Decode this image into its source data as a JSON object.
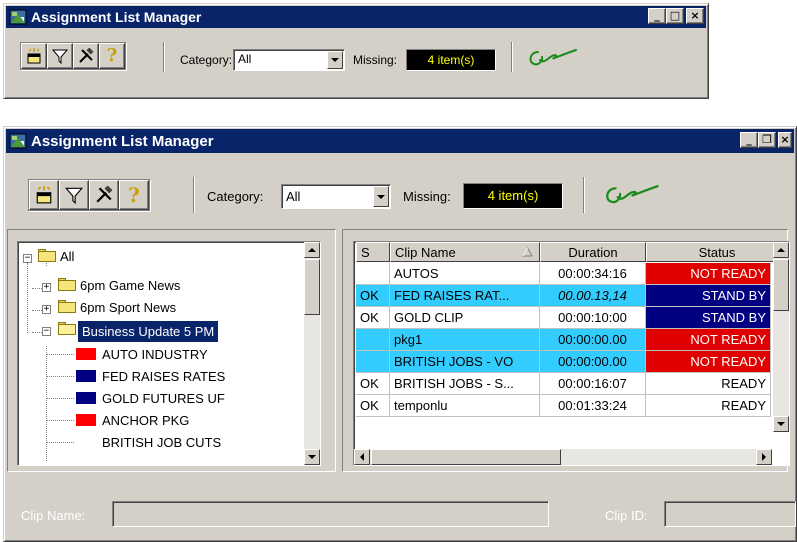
{
  "colors": {
    "titlebar": "#0a246a",
    "selection": "#0a246a",
    "not_ready": "#e00000",
    "stand_by": "#000080",
    "pending_row": "#33ccff",
    "missing_bg": "#000000",
    "missing_text": "#ffff00"
  },
  "small_window": {
    "title": "Assignment List Manager",
    "caption_buttons": [
      "minimize",
      "maximize",
      "close"
    ],
    "toolbar_icons": [
      "new-clip-icon",
      "filter-icon",
      "tools-icon",
      "help-icon"
    ],
    "category_label": "Category:",
    "category_value": "All",
    "missing_label": "Missing:",
    "missing_value": "4 item(s)",
    "signature_icon": "signature-icon"
  },
  "large_window": {
    "title": "Assignment List Manager",
    "caption_buttons": [
      "minimize",
      "restore",
      "close"
    ],
    "category_label": "Category:",
    "category_value": "All",
    "missing_label": "Missing:",
    "missing_value": "4 item(s)",
    "tree": {
      "root": "All",
      "items": [
        {
          "label": "6pm Game News",
          "type": "folder",
          "expanded": false
        },
        {
          "label": "6pm Sport News",
          "type": "folder",
          "expanded": false
        },
        {
          "label": "Business Update 5 PM",
          "type": "folder",
          "expanded": true,
          "selected": true
        },
        {
          "label": "AUTO INDUSTRY",
          "type": "clip",
          "status_color": "red"
        },
        {
          "label": "FED RAISES RATES",
          "type": "clip",
          "status_color": "navy"
        },
        {
          "label": "GOLD FUTURES UF",
          "type": "clip",
          "status_color": "navy"
        },
        {
          "label": "ANCHOR PKG",
          "type": "clip",
          "status_color": "red"
        },
        {
          "label": "BRITISH JOB CUTS",
          "type": "clip",
          "status_color": "none"
        }
      ]
    },
    "grid": {
      "columns": [
        "S",
        "Clip Name",
        "Duration",
        "Status"
      ],
      "sort_indicator": "sort-ascending-icon",
      "rows": [
        {
          "s": "",
          "name": "AUTOS",
          "duration": "00:00:34:16",
          "status": "NOT READY",
          "row_bg": "#ffffff",
          "status_bg": "#e00000",
          "status_fg": "#ffffff",
          "italic": false
        },
        {
          "s": "OK",
          "name": "FED RAISES RAT...",
          "duration": "00.00.13,14",
          "status": "STAND BY",
          "row_bg": "#33ccff",
          "status_bg": "#000080",
          "status_fg": "#ffffff",
          "italic": true
        },
        {
          "s": "OK",
          "name": "GOLD CLIP",
          "duration": "00:00:10:00",
          "status": "STAND BY",
          "row_bg": "#ffffff",
          "status_bg": "#000080",
          "status_fg": "#ffffff",
          "italic": false
        },
        {
          "s": "",
          "name": "pkg1",
          "duration": "00:00:00.00",
          "status": "NOT READY",
          "row_bg": "#33ccff",
          "status_bg": "#e00000",
          "status_fg": "#ffffff",
          "italic": false
        },
        {
          "s": "",
          "name": "BRITISH JOBS - VO",
          "duration": "00:00:00.00",
          "status": "NOT READY",
          "row_bg": "#33ccff",
          "status_bg": "#e00000",
          "status_fg": "#ffffff",
          "italic": false
        },
        {
          "s": "OK",
          "name": "BRITISH JOBS - S...",
          "duration": "00:00:16:07",
          "status": "READY",
          "row_bg": "#ffffff",
          "status_bg": "#ffffff",
          "status_fg": "#000000",
          "italic": false
        },
        {
          "s": "OK",
          "name": "temponlu",
          "duration": "00:01:33:24",
          "status": "READY",
          "row_bg": "#ffffff",
          "status_bg": "#ffffff",
          "status_fg": "#000000",
          "italic": false
        }
      ]
    },
    "clip_name_label": "Clip Name:",
    "clip_name_value": "",
    "clip_id_label": "Clip ID:",
    "clip_id_value": ""
  }
}
